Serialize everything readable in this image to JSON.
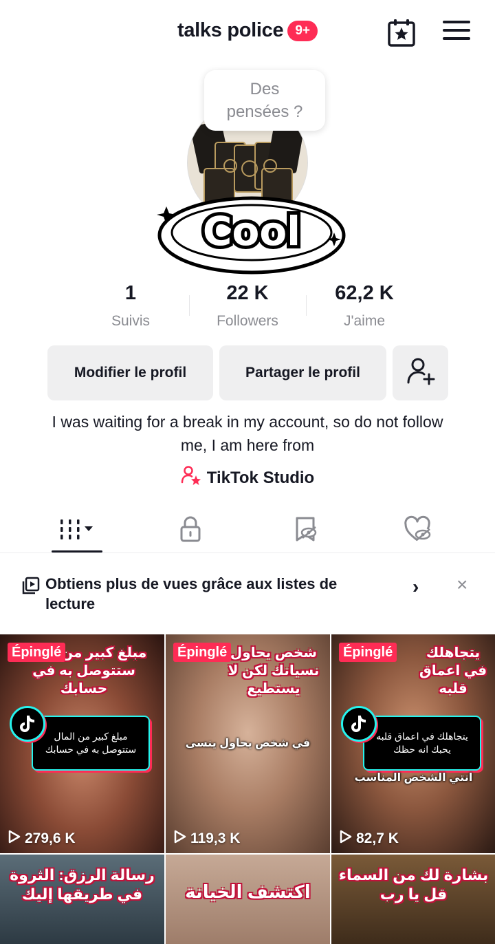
{
  "header": {
    "username": "talks police",
    "notification_badge": "9+",
    "calendar_icon": "calendar-star-icon",
    "menu_icon": "hamburger-menu-icon"
  },
  "profile": {
    "thought_bubble": "Des pensées ?",
    "avatar_logo_text": "Cool"
  },
  "stats": [
    {
      "value": "1",
      "label": "Suivis"
    },
    {
      "value": "22 K",
      "label": "Followers"
    },
    {
      "value": "62,2 K",
      "label": "J'aime"
    }
  ],
  "buttons": {
    "edit_profile": "Modifier le profil",
    "share_profile": "Partager le profil",
    "add_friend_icon": "add-user-icon"
  },
  "bio": "I was waiting for a break in my account, so do not follow me, I am here from",
  "studio_link": "TikTok Studio",
  "tabs": [
    "videos",
    "private",
    "reposts",
    "liked"
  ],
  "banner": {
    "text": "Obtiens plus de vues grâce aux listes de lecture",
    "chevron": "›",
    "close": "×"
  },
  "videos": [
    {
      "pinned": "Épinglé",
      "views": "279,6 K",
      "headline": "مبلغ كبير من المال ستتوصل به في حسابك",
      "card_text": "مبلغ كبير من المال ستتوصل به في حسابك",
      "caption": ""
    },
    {
      "pinned": "Épinglé",
      "views": "119,3 K",
      "headline": "شخص يحاول نسيانك لكن لا يستطيع",
      "card_text": "",
      "caption": "في شخص يحاول ينسى"
    },
    {
      "pinned": "Épinglé",
      "views": "82,7 K",
      "headline": "يتجاهلك في اعماق قلبه",
      "card_text": "يتجاهلك في اعماق قلبه يحبك انه حظك",
      "caption": "انتي الشخص المناسب"
    },
    {
      "pinned": "",
      "views": "",
      "headline": "رسالة الرزق: الثروة في طريقها إليك",
      "card_text": "",
      "caption": ""
    },
    {
      "pinned": "",
      "views": "",
      "headline": "اكتشف الخيانة",
      "card_text": "",
      "caption": ""
    },
    {
      "pinned": "",
      "views": "",
      "headline": "بشارة لك من السماء قل يا رب",
      "card_text": "",
      "caption": ""
    }
  ],
  "colors": {
    "accent": "#fe2c55",
    "cyan": "#25f4ee",
    "text": "#161823",
    "muted": "#8a8b91"
  }
}
